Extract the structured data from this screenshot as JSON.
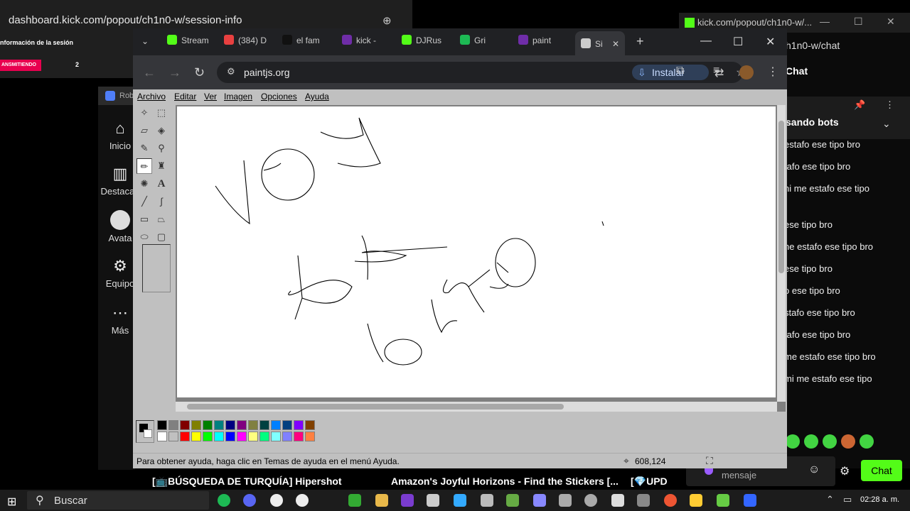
{
  "bg_left": {
    "url": "dashboard.kick.com/popout/ch1n0-w/session-info",
    "section_title": "nformación de la sesión",
    "status_badge": "ANSMITIENDO",
    "count": "2"
  },
  "sidebar": {
    "title": "Rob",
    "items": [
      {
        "label": "Inicio",
        "icon": "home-icon"
      },
      {
        "label": "Destacad",
        "icon": "chart-icon"
      },
      {
        "label": "Avata",
        "icon": "avatar-icon"
      },
      {
        "label": "Equipo",
        "icon": "team-icon"
      },
      {
        "label": "Más",
        "icon": "more-icon"
      }
    ]
  },
  "chat": {
    "window_title": "kick.com/popout/ch1n0-w/...",
    "path": "h1n0-w/chat",
    "header": "Chat",
    "pinned": "sando bots",
    "messages": [
      "estafo ese tipo bro",
      "tafo ese tipo bro",
      "ni me estafo ese tipo",
      "ese tipo bro",
      "ne estafo ese tipo bro",
      "ese tipo bro",
      "o ese tipo bro",
      "stafo ese tipo bro",
      "tafo ese tipo bro",
      "me estafo ese tipo bro",
      "mi me estafo ese tipo"
    ],
    "input_placeholder": "Enviar un mensaje",
    "send_label": "Chat",
    "colors": {
      "accent": "#53fc18"
    }
  },
  "chrome": {
    "tabs": [
      {
        "label": "Stream",
        "color": "#53fc18"
      },
      {
        "label": "(384) D",
        "color": "#e84040"
      },
      {
        "label": "el fam",
        "color": "#111111"
      },
      {
        "label": "kick - ",
        "color": "#6f2da8"
      },
      {
        "label": "DJRus",
        "color": "#53fc18"
      },
      {
        "label": "Gri",
        "color": "#1db954"
      },
      {
        "label": "paint",
        "color": "#6f2da8"
      },
      {
        "label": "Si",
        "color": "#cccccc"
      }
    ],
    "url": "paintjs.org",
    "install_label": "Instalar"
  },
  "paint": {
    "menus": [
      "Archivo",
      "Editar",
      "Ver",
      "Imagen",
      "Opciones",
      "Ayuda"
    ],
    "status_help": "Para obtener ayuda, haga clic en Temas de ayuda en el menú Ayuda.",
    "cursor_coords": "608,124",
    "palette": [
      "#000000",
      "#808080",
      "#800000",
      "#808000",
      "#008000",
      "#008080",
      "#000080",
      "#800080",
      "#808040",
      "#004040",
      "#0080ff",
      "#004080",
      "#8000ff",
      "#804000",
      "#ffffff",
      "#c0c0c0",
      "#ff0000",
      "#ffff00",
      "#00ff00",
      "#00ffff",
      "#0000ff",
      "#ff00ff",
      "#ffff80",
      "#00ff80",
      "#80ffff",
      "#8080ff",
      "#ff0080",
      "#ff8040"
    ]
  },
  "tickers": [
    "[📺BÚSQUEDA DE TURQUÍA] Hipershot",
    "Amazon's Joyful Horizons - Find the Stickers [...",
    "[💎UPD"
  ],
  "taskbar": {
    "search_label": "Buscar",
    "clock": "02:28 a. m."
  }
}
